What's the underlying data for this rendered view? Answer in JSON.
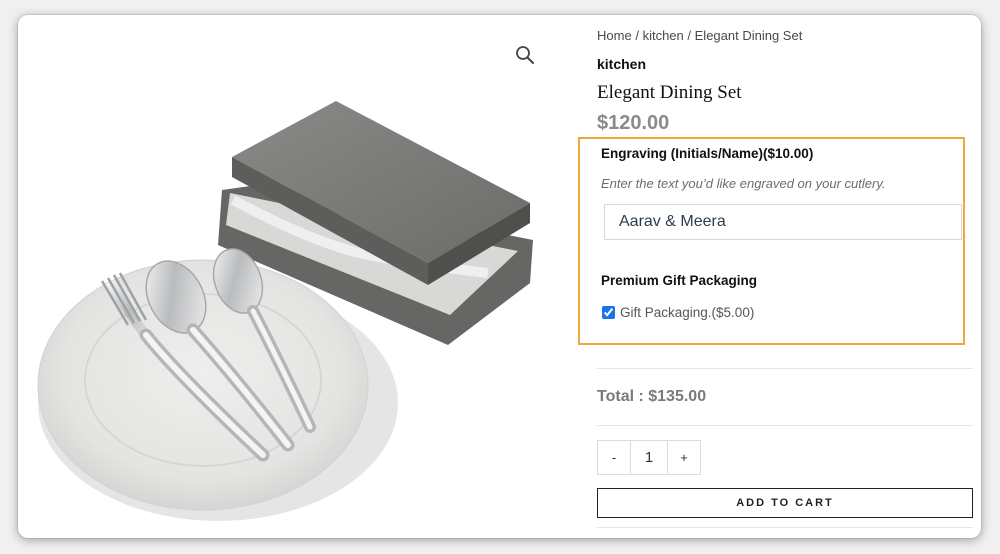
{
  "breadcrumb": {
    "home": "Home",
    "category": "kitchen",
    "current": "Elegant Dining Set",
    "separator": "/"
  },
  "product": {
    "category": "kitchen",
    "title": "Elegant Dining Set",
    "price": "$120.00"
  },
  "options": {
    "engraving": {
      "label": "Engraving (Initials/Name)($10.00)",
      "hint": "Enter the text you’d like engraved on your cutlery.",
      "value": "Aarav & Meera"
    },
    "gift": {
      "section_label": "Premium Gift Packaging",
      "checkbox_label": "Gift Packaging.($5.00)",
      "checked": true
    },
    "highlight_color": "#f2a73b"
  },
  "total": "Total : $135.00",
  "quantity": {
    "minus": "-",
    "value": "1",
    "plus": "+"
  },
  "add_to_cart": "ADD TO CART",
  "icons": {
    "zoom": "magnifier-icon"
  }
}
